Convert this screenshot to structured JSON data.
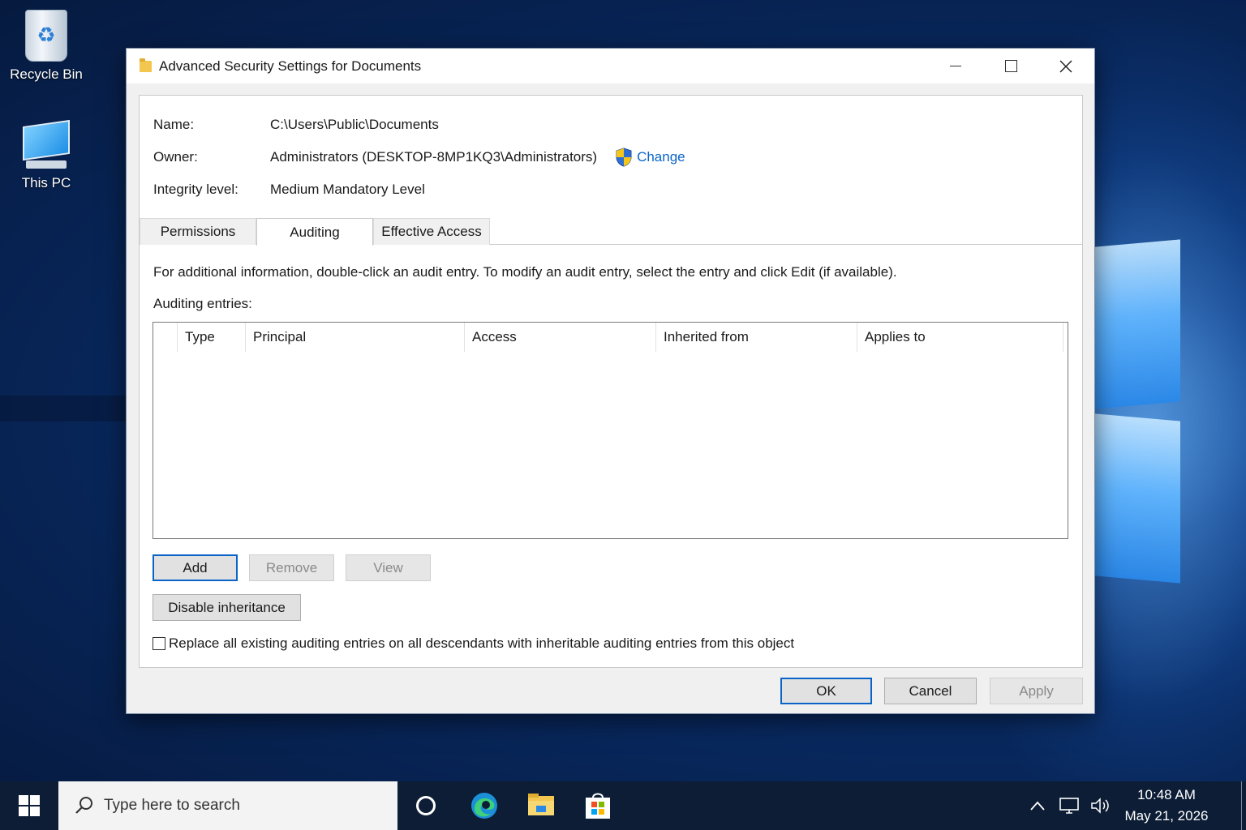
{
  "desktop": {
    "icons": [
      {
        "label": "Recycle Bin",
        "icon": "recycle-bin-icon"
      },
      {
        "label": "This PC",
        "icon": "this-pc-icon"
      }
    ]
  },
  "dialog": {
    "title": "Advanced Security Settings for Documents",
    "title_icon": "folder-icon",
    "info": {
      "name_label": "Name:",
      "name_value": "C:\\Users\\Public\\Documents",
      "owner_label": "Owner:",
      "owner_value": "Administrators (DESKTOP-8MP1KQ3\\Administrators)",
      "change_link": "Change",
      "integrity_label": "Integrity level:",
      "integrity_value": "Medium Mandatory Level"
    },
    "tabs": [
      {
        "label": "Permissions",
        "active": false
      },
      {
        "label": "Auditing",
        "active": true
      },
      {
        "label": "Effective Access",
        "active": false
      }
    ],
    "description": "For additional information, double-click an audit entry. To modify an audit entry, select the entry and click Edit (if available).",
    "entries_label": "Auditing entries:",
    "columns": [
      "Type",
      "Principal",
      "Access",
      "Inherited from",
      "Applies to"
    ],
    "rows": [],
    "buttons": {
      "add": "Add",
      "remove": "Remove",
      "view": "View",
      "disable_inheritance": "Disable inheritance",
      "ok": "OK",
      "cancel": "Cancel",
      "apply": "Apply"
    },
    "replace_checkbox": {
      "label": "Replace all existing auditing entries on all descendants with inheritable auditing entries from this object",
      "checked": false
    }
  },
  "taskbar": {
    "search_placeholder": "Type here to search",
    "pinned": [
      "cortana-icon",
      "edge-icon",
      "file-explorer-icon",
      "store-icon"
    ],
    "tray": [
      "chevron-up-icon",
      "network-icon",
      "volume-icon"
    ],
    "time": "10:48 AM",
    "date": "May 21, 2026"
  },
  "colors": {
    "accent": "#0a64c8",
    "taskbar": "#0c1d35"
  }
}
